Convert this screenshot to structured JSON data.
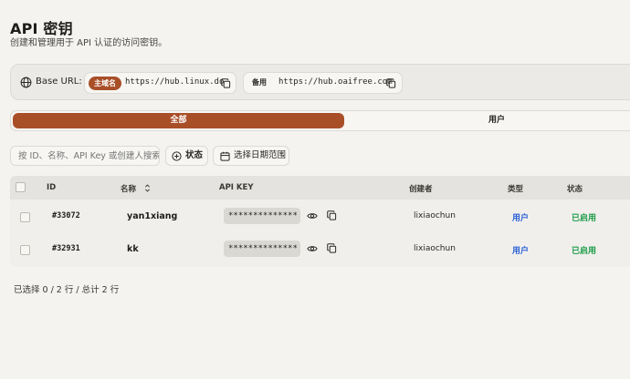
{
  "page": {
    "title": "API 密钥",
    "subtitle": "创建和管理用于 API 认证的访问密钥。"
  },
  "base_url": {
    "label": "Base URL:",
    "primary": {
      "tag": "主域名",
      "url": "https://hub.linux.do"
    },
    "backup": {
      "tag": "备用",
      "url": "https://hub.oaifree.com"
    }
  },
  "tabs": [
    {
      "label": "全部",
      "active": true
    },
    {
      "label": "用户",
      "active": false
    }
  ],
  "filters": {
    "search_placeholder": "按 ID、名称、API Key 或创建人搜索",
    "status_label": "状态",
    "date_label": "选择日期范围"
  },
  "table": {
    "headers": {
      "id": "ID",
      "name": "名称",
      "api_key": "API KEY",
      "creator": "创建者",
      "type": "类型",
      "status": "状态"
    },
    "rows": [
      {
        "id": "#33072",
        "name": "yan1xiang",
        "api_key": "**************",
        "creator": "lixiaochun",
        "type": "用户",
        "status": "已启用"
      },
      {
        "id": "#32931",
        "name": "kk",
        "api_key": "**************",
        "creator": "lixiaochun",
        "type": "用户",
        "status": "已启用"
      }
    ]
  },
  "footer": {
    "selection": "已选择 0 / 2 行 / 总计 2 行"
  },
  "colors": {
    "accent": "#a94f28",
    "type_link": "#2f63d6",
    "status_enabled": "#1f9d4a",
    "background": "#f4f3f0"
  }
}
